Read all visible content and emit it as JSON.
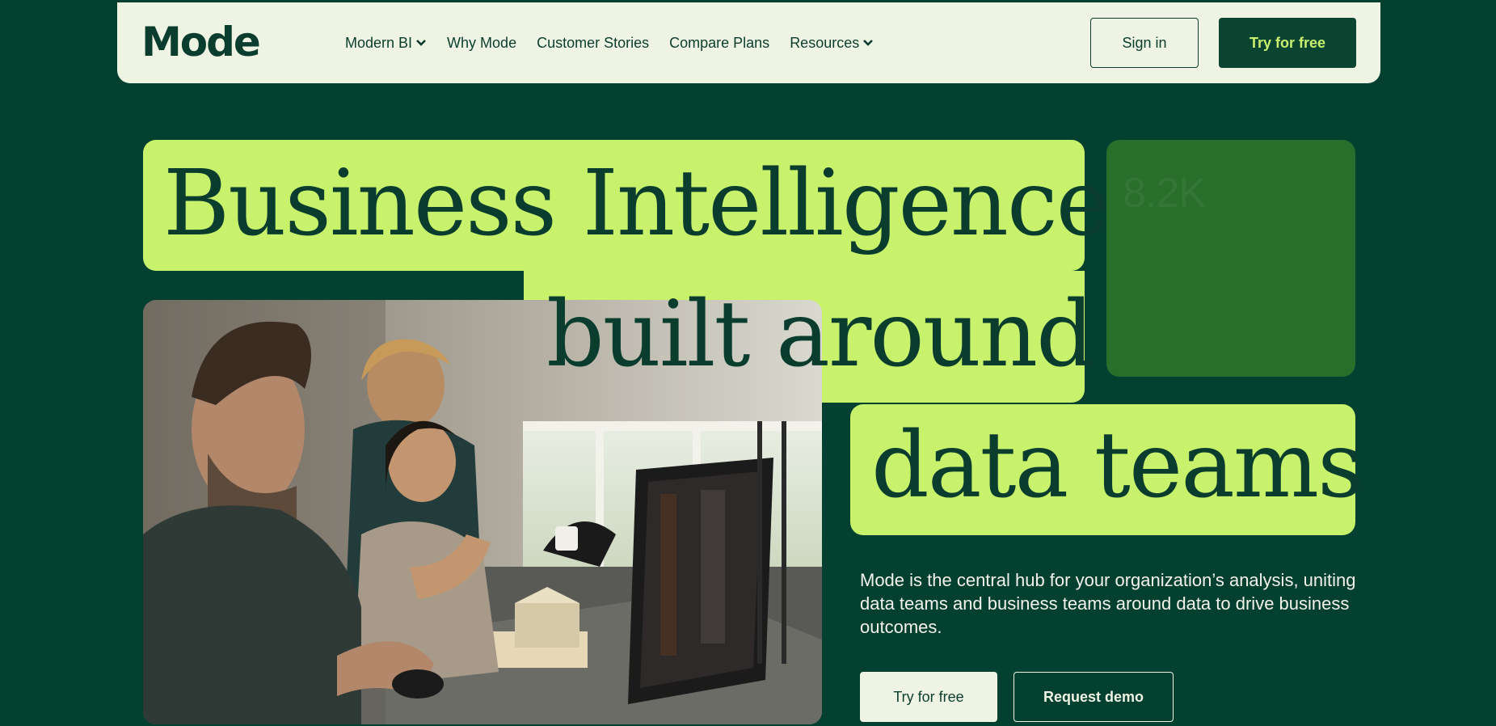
{
  "nav": {
    "logo": "Mode",
    "links": [
      {
        "label": "Modern BI",
        "has_dropdown": true
      },
      {
        "label": "Why Mode",
        "has_dropdown": false
      },
      {
        "label": "Customer Stories",
        "has_dropdown": false
      },
      {
        "label": "Compare Plans",
        "has_dropdown": false
      },
      {
        "label": "Resources",
        "has_dropdown": true
      }
    ],
    "sign_in": "Sign in",
    "try_free": "Try for free"
  },
  "hero": {
    "line1": "Business Intelligence",
    "line2": "built around",
    "line3": "data teams",
    "stat": "8.2K",
    "description": "Mode is the central hub for your organization’s analysis, uniting data teams and business teams around data to drive business outcomes.",
    "cta_primary": "Try for free",
    "cta_secondary": "Request demo"
  },
  "colors": {
    "background": "#044030",
    "lime": "#c8f26b",
    "nav_bg": "#eef3e3",
    "text_dark": "#0b3d2e",
    "stat_card": "#2a6e2c"
  }
}
